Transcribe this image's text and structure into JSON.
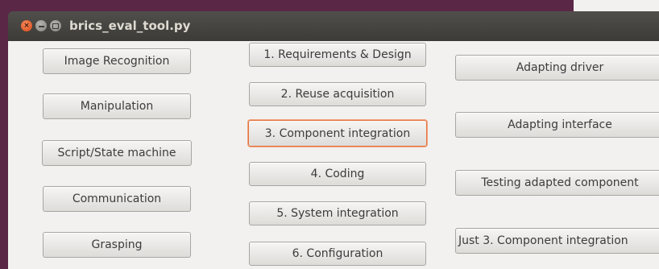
{
  "window": {
    "title": "brics_eval_tool.py",
    "close_glyph": "×"
  },
  "colors": {
    "accent_focus": "#e4743c",
    "titlebar": "#3c3b37",
    "desktop": "#5a2747",
    "content_bg": "#f2f1f0"
  },
  "icons": {
    "close": "close-icon",
    "minimize": "minimize-icon",
    "maximize": "maximize-icon"
  },
  "columns": {
    "left": [
      "Image Recognition",
      "Manipulation",
      "Script/State machine",
      "Communication",
      "Grasping"
    ],
    "middle": [
      "1. Requirements & Design",
      "2. Reuse acquisition",
      "3. Component integration",
      "4. Coding",
      "5. System integration",
      "6. Configuration"
    ],
    "right": [
      "Adapting driver",
      "Adapting interface",
      "Testing adapted component",
      "Just 3. Component integration"
    ]
  },
  "focused_button": "3. Component integration"
}
